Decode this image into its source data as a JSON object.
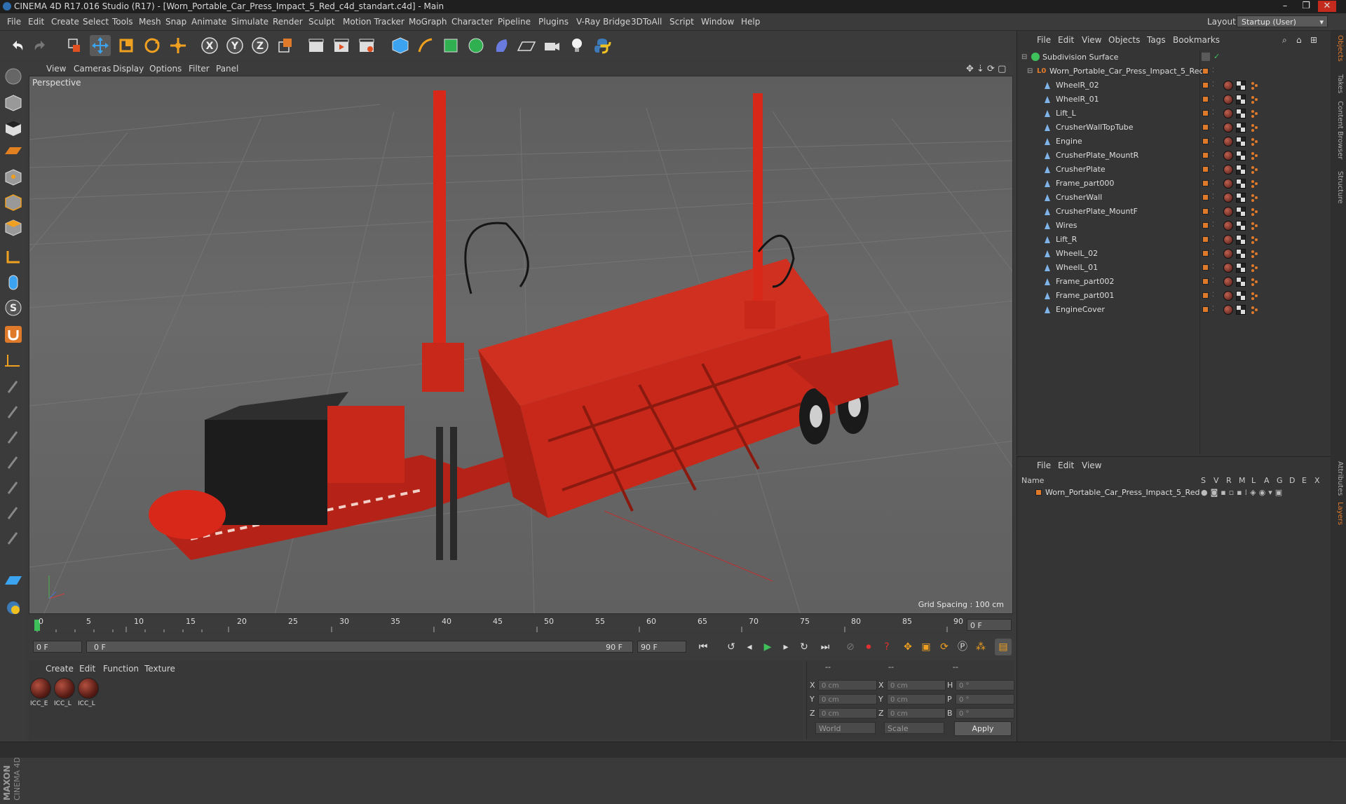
{
  "window": {
    "title": "CINEMA 4D R17.016 Studio (R17) - [Worn_Portable_Car_Press_Impact_5_Red_c4d_standart.c4d] - Main",
    "minimize": "–",
    "maximize": "❐",
    "close": "✕"
  },
  "menubar": {
    "items": [
      "File",
      "Edit",
      "Create",
      "Select",
      "Tools",
      "Mesh",
      "Snap",
      "Animate",
      "Simulate",
      "Render",
      "Sculpt",
      "Motion Tracker",
      "MoGraph",
      "Character",
      "Pipeline",
      "Plugins",
      "V-Ray Bridge",
      "3DToAll",
      "Script",
      "Window",
      "Help"
    ],
    "layout_label": "Layout:",
    "layout_value": "Startup (User)"
  },
  "viewport": {
    "menu": [
      "View",
      "Cameras",
      "Display",
      "Options",
      "Filter",
      "Panel"
    ],
    "camera_label": "Perspective",
    "grid_spacing": "Grid Spacing : 100 cm"
  },
  "timeline": {
    "ticks": [
      "0",
      "5",
      "10",
      "15",
      "20",
      "25",
      "30",
      "35",
      "40",
      "45",
      "50",
      "55",
      "60",
      "65",
      "70",
      "75",
      "80",
      "85",
      "90"
    ],
    "current_frame": "0 F"
  },
  "playbar": {
    "start_field": "0 F",
    "range_start": "0 F",
    "range_end": "90 F",
    "end_field": "90 F"
  },
  "material_panel": {
    "menu": [
      "Create",
      "Edit",
      "Function",
      "Texture"
    ],
    "materials": [
      "ICC_E",
      "ICC_L",
      "ICC_L"
    ]
  },
  "coordinates": {
    "header": [
      "--",
      "--",
      "--"
    ],
    "rows": [
      {
        "a": "X",
        "av": "0 cm",
        "b": "X",
        "bv": "0 cm",
        "c": "H",
        "cv": "0 °"
      },
      {
        "a": "Y",
        "av": "0 cm",
        "b": "Y",
        "bv": "0 cm",
        "c": "P",
        "cv": "0 °"
      },
      {
        "a": "Z",
        "av": "0 cm",
        "b": "Z",
        "bv": "0 cm",
        "c": "B",
        "cv": "0 °"
      }
    ],
    "mode": "World",
    "transform": "Scale",
    "apply": "Apply"
  },
  "object_manager": {
    "menu": [
      "File",
      "Edit",
      "View",
      "Objects",
      "Tags",
      "Bookmarks"
    ],
    "root": "Subdivision Surface",
    "group": "Worn_Portable_Car_Press_Impact_5_Red",
    "children": [
      "WheelR_02",
      "WheelR_01",
      "Lift_L",
      "CrusherWallTopTube",
      "Engine",
      "CrusherPlate_MountR",
      "CrusherPlate",
      "Frame_part000",
      "CrusherWall",
      "CrusherPlate_MountF",
      "Wires",
      "Lift_R",
      "WheelL_02",
      "WheelL_01",
      "Frame_part002",
      "Frame_part001",
      "EngineCover"
    ]
  },
  "layer_manager": {
    "menu": [
      "File",
      "Edit",
      "View"
    ],
    "columns": [
      "Name",
      "S",
      "V",
      "R",
      "M",
      "L",
      "A",
      "G",
      "D",
      "E",
      "X"
    ],
    "layer": "Worn_Portable_Car_Press_Impact_5_Red"
  },
  "right_tabs": [
    "Objects",
    "Takes",
    "Content Browser",
    "Structure",
    "Attributes",
    "Layers"
  ],
  "logo": {
    "line1": "MAXON",
    "line2": "CINEMA 4D"
  },
  "colors": {
    "accent": "#e07a2b",
    "model_red": "#c8281a",
    "panel": "#353535"
  }
}
